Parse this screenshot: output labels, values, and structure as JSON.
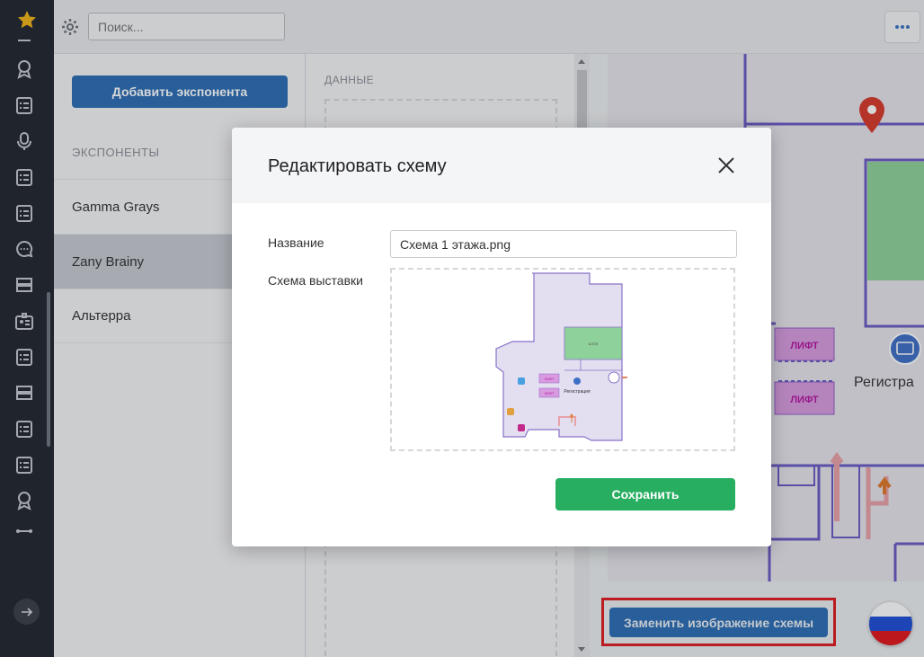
{
  "topbar": {
    "search_placeholder": "Поиск..."
  },
  "sidebar": {
    "add_button_label": "Добавить экспонента",
    "section_label": "ЭКСПОНЕНТЫ",
    "items": [
      {
        "label": "Gamma Grays"
      },
      {
        "label": "Zany Brainy"
      },
      {
        "label": "Альтерра"
      }
    ],
    "selected_index": 1
  },
  "data_panel": {
    "label": "ДАННЫЕ"
  },
  "map": {
    "lift_label_1": "ЛИФТ",
    "lift_label_2": "ЛИФТ",
    "registration_label": "Регистра",
    "replace_button_label": "Заменить изображение схемы"
  },
  "modal": {
    "title": "Редактировать схему",
    "name_label": "Название",
    "name_value": "Схема 1 этажа.png",
    "scheme_label": "Схема выставки",
    "save_label": "Сохранить",
    "thumb_lift_1": "ЛИФТ",
    "thumb_lift_2": "ЛИФТ",
    "thumb_registration": "Регистрация",
    "thumb_block": "БЛОК"
  },
  "colors": {
    "primary": "#2c6db4",
    "success": "#27ae60",
    "highlight": "#e01b22",
    "rail": "#23272f",
    "map_lift": "#d89be0",
    "map_lift_text": "#b5169f",
    "map_green": "#8fd19a"
  },
  "language_flag": [
    "#ffffff",
    "#1f4fd6",
    "#e0161b"
  ]
}
